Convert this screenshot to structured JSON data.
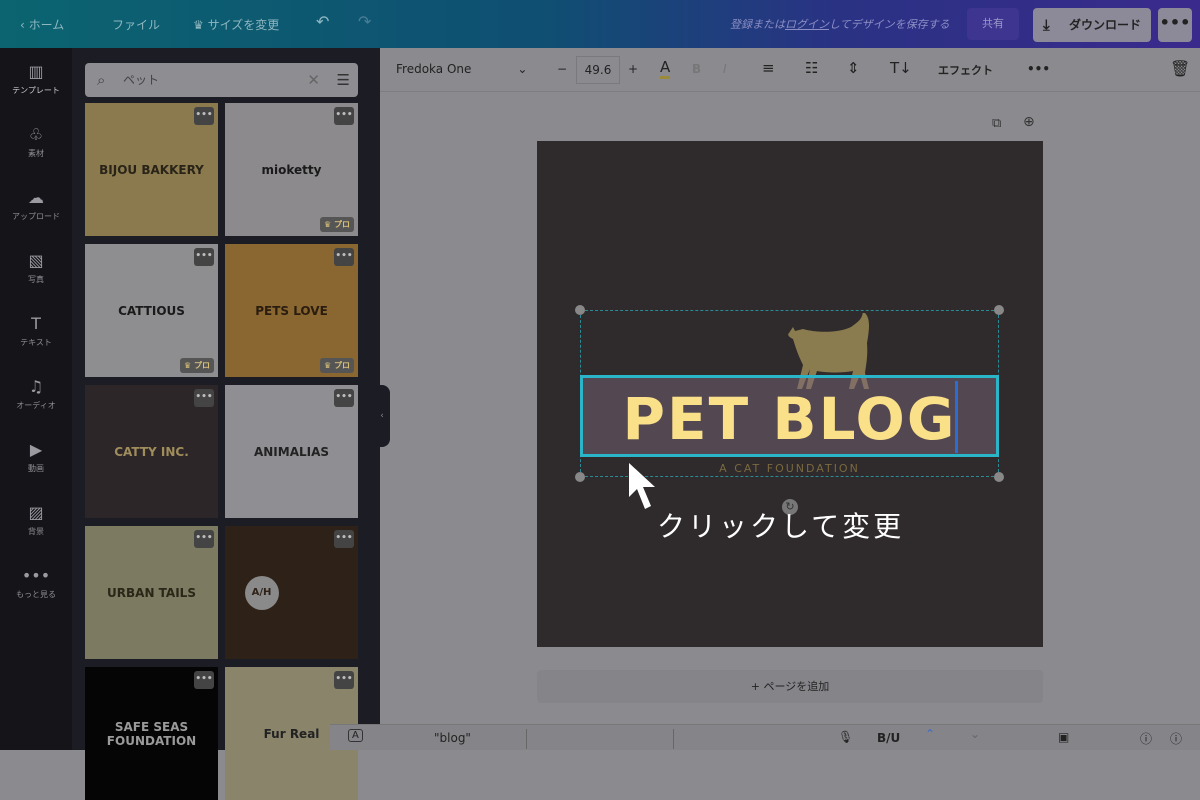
{
  "topbar": {
    "home": "ホーム",
    "file": "ファイル",
    "resize": "サイズを変更",
    "save_prompt_prefix": "登録または",
    "login": "ログイン",
    "save_prompt_suffix": "してデザインを保存する",
    "share": "共有",
    "download": "ダウンロード",
    "more": "•••"
  },
  "sidebar": {
    "items": [
      {
        "label": "テンプレート",
        "icon": "▥"
      },
      {
        "label": "素材",
        "icon": "♧"
      },
      {
        "label": "アップロード",
        "icon": "☁"
      },
      {
        "label": "写真",
        "icon": "▧"
      },
      {
        "label": "テキスト",
        "icon": "T"
      },
      {
        "label": "オーディオ",
        "icon": "♫"
      },
      {
        "label": "動画",
        "icon": "▶"
      },
      {
        "label": "背景",
        "icon": "▨"
      },
      {
        "label": "もっと見る",
        "icon": "•••"
      }
    ]
  },
  "search": {
    "value": "ペット"
  },
  "templates": [
    {
      "text": "BIJOU BAKKERY",
      "bg": "#8a7a4e",
      "fg": "#2a2418",
      "pro": ""
    },
    {
      "text": "mioketty",
      "bg": "#8c8a8d",
      "fg": "#1a1a1a",
      "pro": "プロ"
    },
    {
      "text": "CATTIOUS",
      "bg": "#8e8e90",
      "fg": "#1a1a1a",
      "pro": "プロ"
    },
    {
      "text": "PETS LOVE",
      "bg": "#8a6630",
      "fg": "#2a1d10",
      "pro": "プロ"
    },
    {
      "text": "CATTY INC.",
      "bg": "#2d2628",
      "fg": "#a08d5c",
      "pro": ""
    },
    {
      "text": "ANIMALIAS",
      "bg": "#8f8f93",
      "fg": "#222",
      "pro": ""
    },
    {
      "text": "URBAN TAILS",
      "bg": "#7c7a60",
      "fg": "#2a2618",
      "pro": ""
    },
    {
      "text": "A/H",
      "bg": "#2e2118",
      "fg": "#2e2118",
      "pro": ""
    },
    {
      "text": "SAFE SEAS FOUNDATION",
      "bg": "#050505",
      "fg": "#9a9a9a",
      "pro": ""
    },
    {
      "text": "Fur Real",
      "bg": "#89846a",
      "fg": "#222",
      "pro": ""
    }
  ],
  "toolbar": {
    "font": "Fredoka One",
    "size": "49.6",
    "text_color": "A",
    "bold": "B",
    "italic": "I",
    "effects": "エフェクト",
    "more": "•••"
  },
  "canvas": {
    "title": "PET BLOG",
    "subtitle": "A CAT FOUNDATION",
    "annotation": "クリックして変更",
    "bg": "#2f2a2b",
    "title_color": "#fbe08a",
    "selection_color": "#2bb5c8"
  },
  "add_page": "+ ページを追加",
  "keyboard": {
    "suggestion": "\"blog\"",
    "format": "B/U"
  }
}
